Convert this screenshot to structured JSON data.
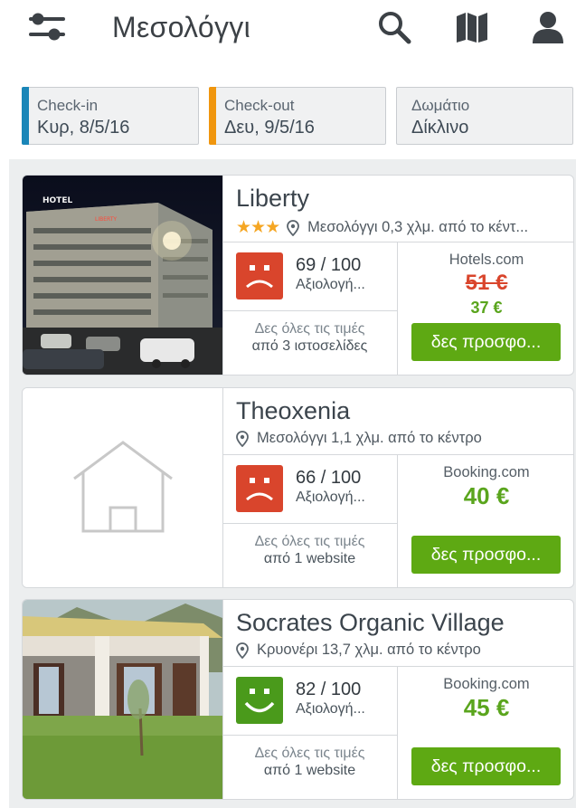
{
  "header": {
    "title": "Μεσολόγγι",
    "icons": [
      "filter-sliders-icon",
      "search-icon",
      "map-icon",
      "user-icon"
    ]
  },
  "filters": {
    "checkin": {
      "label": "Check-in",
      "value": "Κυρ, 8/5/16",
      "accent": "#1a86b8"
    },
    "checkout": {
      "label": "Check-out",
      "value": "Δευ, 9/5/16",
      "accent": "#f0960e"
    },
    "room": {
      "label": "Δωμάτιο",
      "value": "Δίκλινο"
    }
  },
  "hotels": [
    {
      "name": "Liberty",
      "stars": "★★★",
      "location": "Μεσολόγγι 0,3 χλμ. από το κέντ...",
      "rating_score": "69 / 100",
      "rating_label": "Αξιολογή...",
      "rating_mood": "bad",
      "prices_line1": "Δες όλες τις τιμές",
      "prices_line2": "από 3 ιστοσελίδες",
      "provider": "Hotels.com",
      "old_price": "51 €",
      "price": "37 €",
      "deal_label": "δες προσφο..."
    },
    {
      "name": "Theoxenia",
      "location": "Μεσολόγγι 1,1 χλμ. από το κέντρο",
      "rating_score": "66 / 100",
      "rating_label": "Αξιολογή...",
      "rating_mood": "bad",
      "prices_line1": "Δες όλες τις τιμές",
      "prices_line2": "από 1 website",
      "provider": "Booking.com",
      "price": "40 €",
      "deal_label": "δες προσφο..."
    },
    {
      "name": "Socrates Organic Village",
      "location": "Κρυονέρι 13,7 χλμ. από το κέντρο",
      "rating_score": "82 / 100",
      "rating_label": "Αξιολογή...",
      "rating_mood": "good",
      "prices_line1": "Δες όλες τις τιμές",
      "prices_line2": "από 1 website",
      "provider": "Booking.com",
      "price": "45 €",
      "deal_label": "δες προσφο..."
    }
  ],
  "colors": {
    "bad_rating": "#d9452c",
    "good_rating": "#4a9a1b",
    "deal_button": "#5ea913",
    "star": "#f5a623"
  }
}
